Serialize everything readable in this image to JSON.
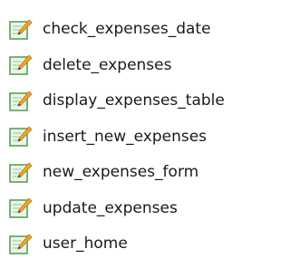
{
  "files": [
    {
      "name": "check_expenses_date",
      "icon": "php-script-icon"
    },
    {
      "name": "delete_expenses",
      "icon": "php-script-icon"
    },
    {
      "name": "display_expenses_table",
      "icon": "php-script-icon"
    },
    {
      "name": "insert_new_expenses",
      "icon": "php-script-icon"
    },
    {
      "name": "new_expenses_form",
      "icon": "php-script-icon"
    },
    {
      "name": "update_expenses",
      "icon": "php-script-icon"
    },
    {
      "name": "user_home",
      "icon": "php-script-icon"
    }
  ],
  "colors": {
    "icon_page": "#e9f5ea",
    "icon_border": "#4f9a4b",
    "icon_pencil": "#f2a623",
    "icon_pencil_tip": "#3a3a3a",
    "text": "#1a1a1a"
  }
}
